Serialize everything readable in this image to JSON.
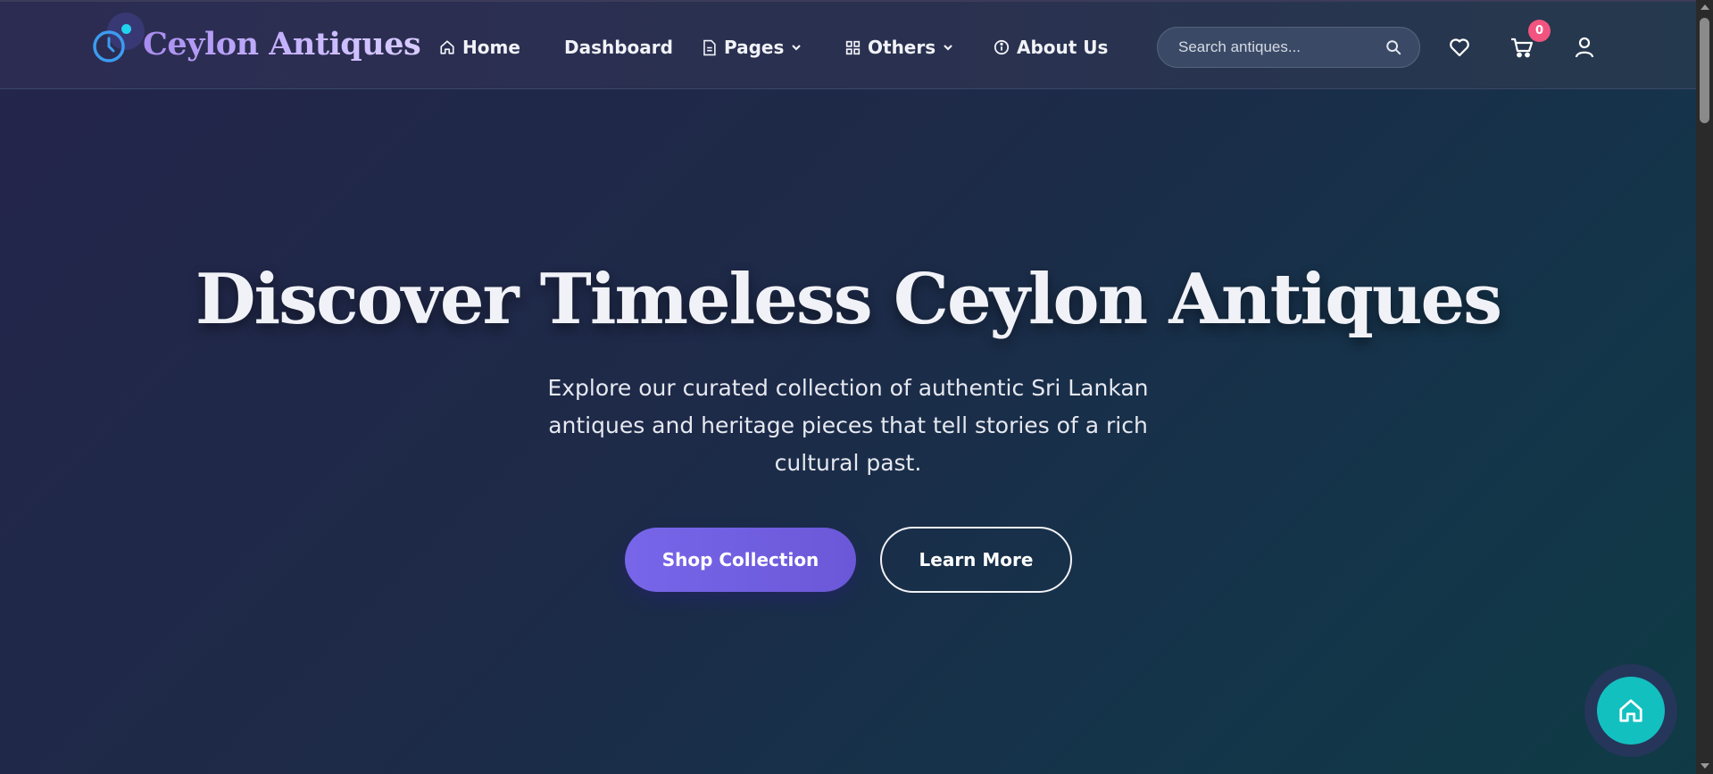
{
  "brand": {
    "name": "Ceylon Antiques"
  },
  "nav": {
    "home": {
      "label": "Home",
      "icon": "home-icon"
    },
    "dashboard": {
      "label": "Dashboard"
    },
    "pages": {
      "label": "Pages",
      "icon": "document-icon"
    },
    "others": {
      "label": "Others",
      "icon": "grid-icon"
    },
    "about": {
      "label": "About Us",
      "icon": "info-icon"
    }
  },
  "search": {
    "placeholder": "Search antiques..."
  },
  "header_icons": {
    "wishlist": "heart-icon",
    "cart": "cart-icon",
    "account": "user-icon",
    "cart_count": "0"
  },
  "hero": {
    "title": "Discover Timeless Ceylon Antiques",
    "subtitle": "Explore our curated collection of authentic Sri Lankan antiques and heritage pieces that tell stories of a rich cultural past.",
    "primary_button": "Shop Collection",
    "secondary_button": "Learn More"
  },
  "fab": {
    "icon": "home-icon"
  },
  "colors": {
    "accent": "#7866ea",
    "brand_text": "#b8a4ff",
    "cart_badge": "#f2547f",
    "fab": "#13c0c0",
    "logo_dot": "#22d3ee"
  }
}
